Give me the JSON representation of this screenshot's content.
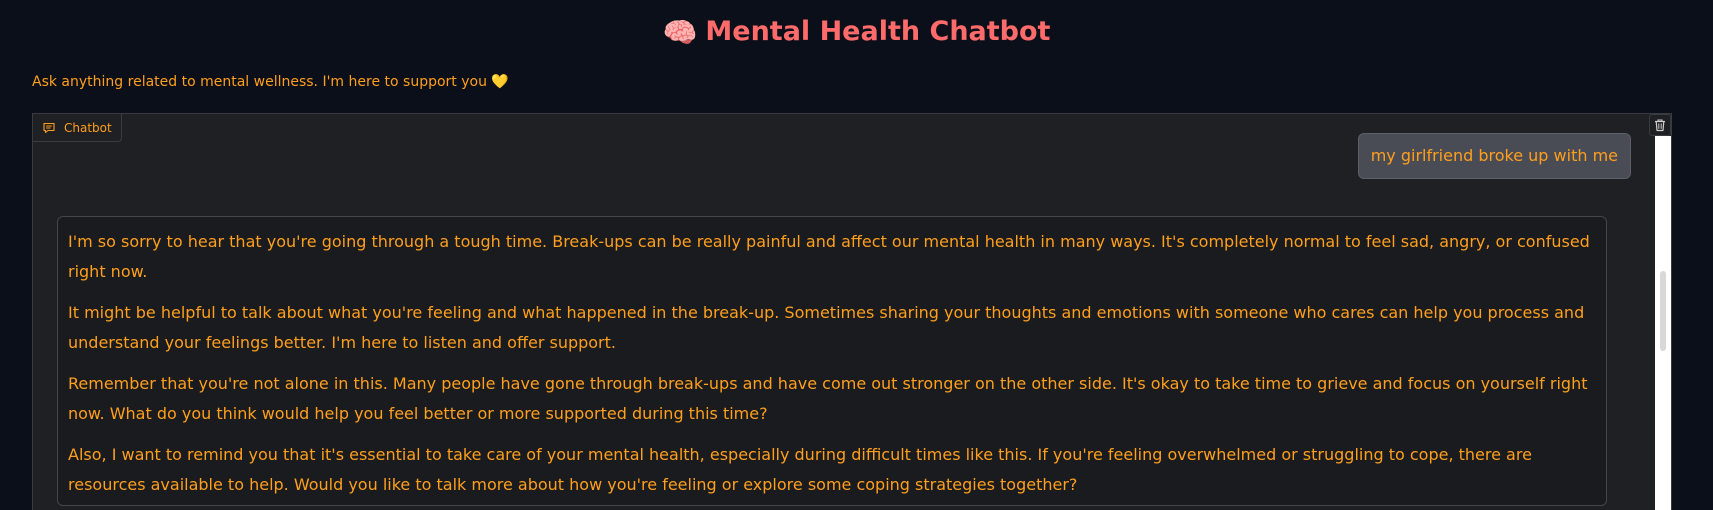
{
  "header": {
    "emoji": "🧠",
    "title": "Mental Health Chatbot"
  },
  "subtitle": "Ask anything related to mental wellness. I'm here to support you 💛",
  "chatbot": {
    "tab_label": "Chatbot",
    "tab_icon": "chat-bubble-icon",
    "clear_icon": "trash-icon",
    "messages": [
      {
        "role": "user",
        "text": "my girlfriend broke up with me"
      },
      {
        "role": "assistant",
        "paragraphs": [
          "I'm so sorry to hear that you're going through a tough time. Break-ups can be really painful and affect our mental health in many ways. It's completely normal to feel sad, angry, or confused right now.",
          "It might be helpful to talk about what you're feeling and what happened in the break-up. Sometimes sharing your thoughts and emotions with someone who cares can help you process and understand your feelings better. I'm here to listen and offer support.",
          "Remember that you're not alone in this. Many people have gone through break-ups and have come out stronger on the other side. It's okay to take time to grieve and focus on yourself right now. What do you think would help you feel better or more supported during this time?",
          "Also, I want to remind you that it's essential to take care of your mental health, especially during difficult times like this. If you're feeling overwhelmed or struggling to cope, there are resources available to help. Would you like to talk more about how you're feeling or explore some coping strategies together?"
        ]
      }
    ]
  },
  "colors": {
    "background": "#0b0f19",
    "title": "#ff6b6b",
    "text_accent": "#ff9f1c",
    "panel": "#1f2023",
    "user_bubble": "#4a4c55"
  }
}
